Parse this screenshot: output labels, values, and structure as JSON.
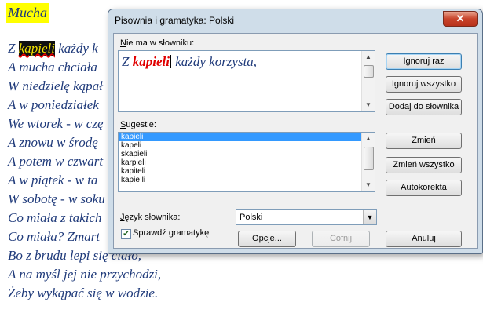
{
  "document": {
    "title": "Mucha",
    "lines": [
      {
        "before": "Z ",
        "highlight": "kapieli",
        "after": " każdy k"
      },
      {
        "text": "A mucha chciała "
      },
      {
        "text": "W niedzielę kąpał"
      },
      {
        "text": "A w poniedziałek"
      },
      {
        "text": "We wtorek - w czę"
      },
      {
        "text": "A znowu w środę"
      },
      {
        "text": "A potem w czwart"
      },
      {
        "text": "A w piątek - w ta"
      },
      {
        "text": "W sobotę - w soku"
      },
      {
        "text": "Co miała z takich"
      },
      {
        "text": "Co miała? Zmart"
      },
      {
        "text": "Bo z brudu lepi się ciało,"
      },
      {
        "text": "A na myśl jej nie przychodzi,"
      },
      {
        "text": "Żeby wykąpać się w wodzie."
      }
    ]
  },
  "dialog": {
    "title": "Pisownia i gramatyka: Polski",
    "close_glyph": "✕",
    "not_in_dictionary_label_u": "N",
    "not_in_dictionary_label_rest": "ie ma w słowniku:",
    "sentence_before": "Z ",
    "sentence_error": "kapieli",
    "sentence_after": " każdy korzysta,",
    "suggestions_label_u": "S",
    "suggestions_label_rest": "ugestie:",
    "suggestions": [
      "kapieli",
      "kapeli",
      "skapieli",
      "karpieli",
      "kapiteli",
      "kapie li"
    ],
    "selected_suggestion_index": 0,
    "language_label_u": "J",
    "language_label_rest": "ęzyk słownika:",
    "language_value": "Polski",
    "check_grammar_label": "Sprawdź gramatykę",
    "check_grammar_checked": true,
    "buttons": {
      "ignore_once": "Ignoruj raz",
      "ignore_all": "Ignoruj wszystko",
      "add_to_dictionary": "Dodaj do słownika",
      "change": "Zmień",
      "change_all": "Zmień wszystko",
      "autocorrect": "Autokorekta",
      "options": "Opcje...",
      "undo": "Cofnij",
      "cancel": "Anuluj"
    }
  }
}
